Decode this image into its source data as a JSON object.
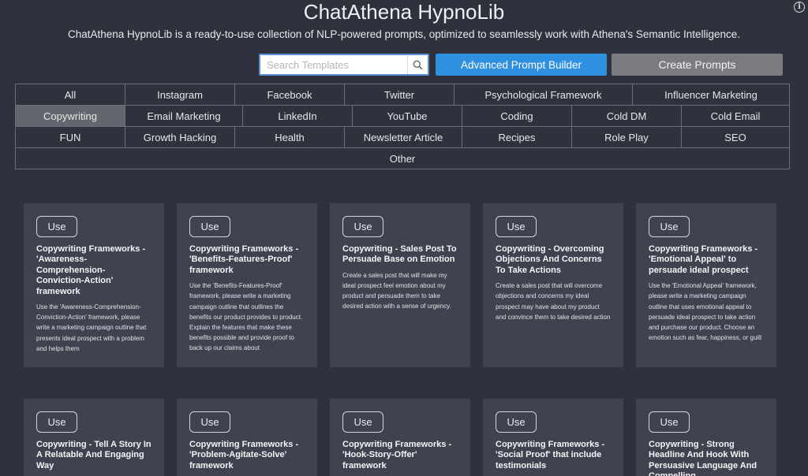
{
  "header": {
    "title": "ChatAthena HypnoLib",
    "subtitle": "ChatAthena HypnoLib is a ready-to-use collection of NLP-powered prompts, optimized to seamlessly work with Athena's Semantic Intelligence."
  },
  "search": {
    "placeholder": "Search Templates"
  },
  "buttons": {
    "advanced": "Advanced Prompt Builder",
    "create": "Create Prompts"
  },
  "categories": {
    "row1": [
      "All",
      "Instagram",
      "Facebook",
      "Twitter",
      "Psychological Framework",
      "Influencer Marketing"
    ],
    "row2": [
      "Copywriting",
      "Email Marketing",
      "LinkedIn",
      "YouTube",
      "Coding",
      "Cold DM",
      "Cold Email"
    ],
    "row3": [
      "FUN",
      "Growth Hacking",
      "Health",
      "Newsletter Article",
      "Recipes",
      "Role Play",
      "SEO"
    ],
    "row4": [
      "Other"
    ],
    "active": "Copywriting"
  },
  "cards": [
    {
      "use": "Use",
      "title": "Copywriting Frameworks - 'Awareness-Comprehension-Conviction-Action' framework",
      "desc": "Use the 'Awareness-Comprehension-Conviction-Action' framework, please write a marketing campaign outline that presents ideal prospect with a problem and helps them"
    },
    {
      "use": "Use",
      "title": "Copywriting Frameworks - 'Benefits-Features-Proof' framework",
      "desc": "Use the 'Benefits-Features-Proof' framework, please write a marketing campaign outline that outlines the benefits our product provides to product. Explain the features that make these benefits possible and provide proof to back up our claims about"
    },
    {
      "use": "Use",
      "title": "Copywriting - Sales Post To Persuade Base on Emotion",
      "desc": "Create a sales post that will make my ideal prospect feel emotion about my product and persuade them to take desired action with a sense of urgency."
    },
    {
      "use": "Use",
      "title": "Copywriting - Overcoming Objections And Concerns To Take Actions",
      "desc": "Create a sales post that will overcome objections and concerns my ideal prospect may have about my product and convince them to take desired action"
    },
    {
      "use": "Use",
      "title": "Copywriting Frameworks - 'Emotional Appeal' to persuade ideal prospect",
      "desc": "Use the 'Emotional Appeal' framework, please write a marketing campaign outline that uses emotional appeal to persuade ideal prospect to take action and purchase our product. Choose an emotion such as fear, happiness, or guilt"
    },
    {
      "use": "Use",
      "title": "Copywriting - Tell A Story In A Relatable And Engaging Way",
      "desc": ""
    },
    {
      "use": "Use",
      "title": "Copywriting Frameworks - 'Problem-Agitate-Solve' framework",
      "desc": ""
    },
    {
      "use": "Use",
      "title": "Copywriting Frameworks - 'Hook-Story-Offer' framework",
      "desc": ""
    },
    {
      "use": "Use",
      "title": "Copywriting Frameworks - 'Social Proof' that include testimonials",
      "desc": ""
    },
    {
      "use": "Use",
      "title": "Copywriting - Strong Headline And Hook With Persuasive Language And Compelling",
      "desc": ""
    }
  ]
}
